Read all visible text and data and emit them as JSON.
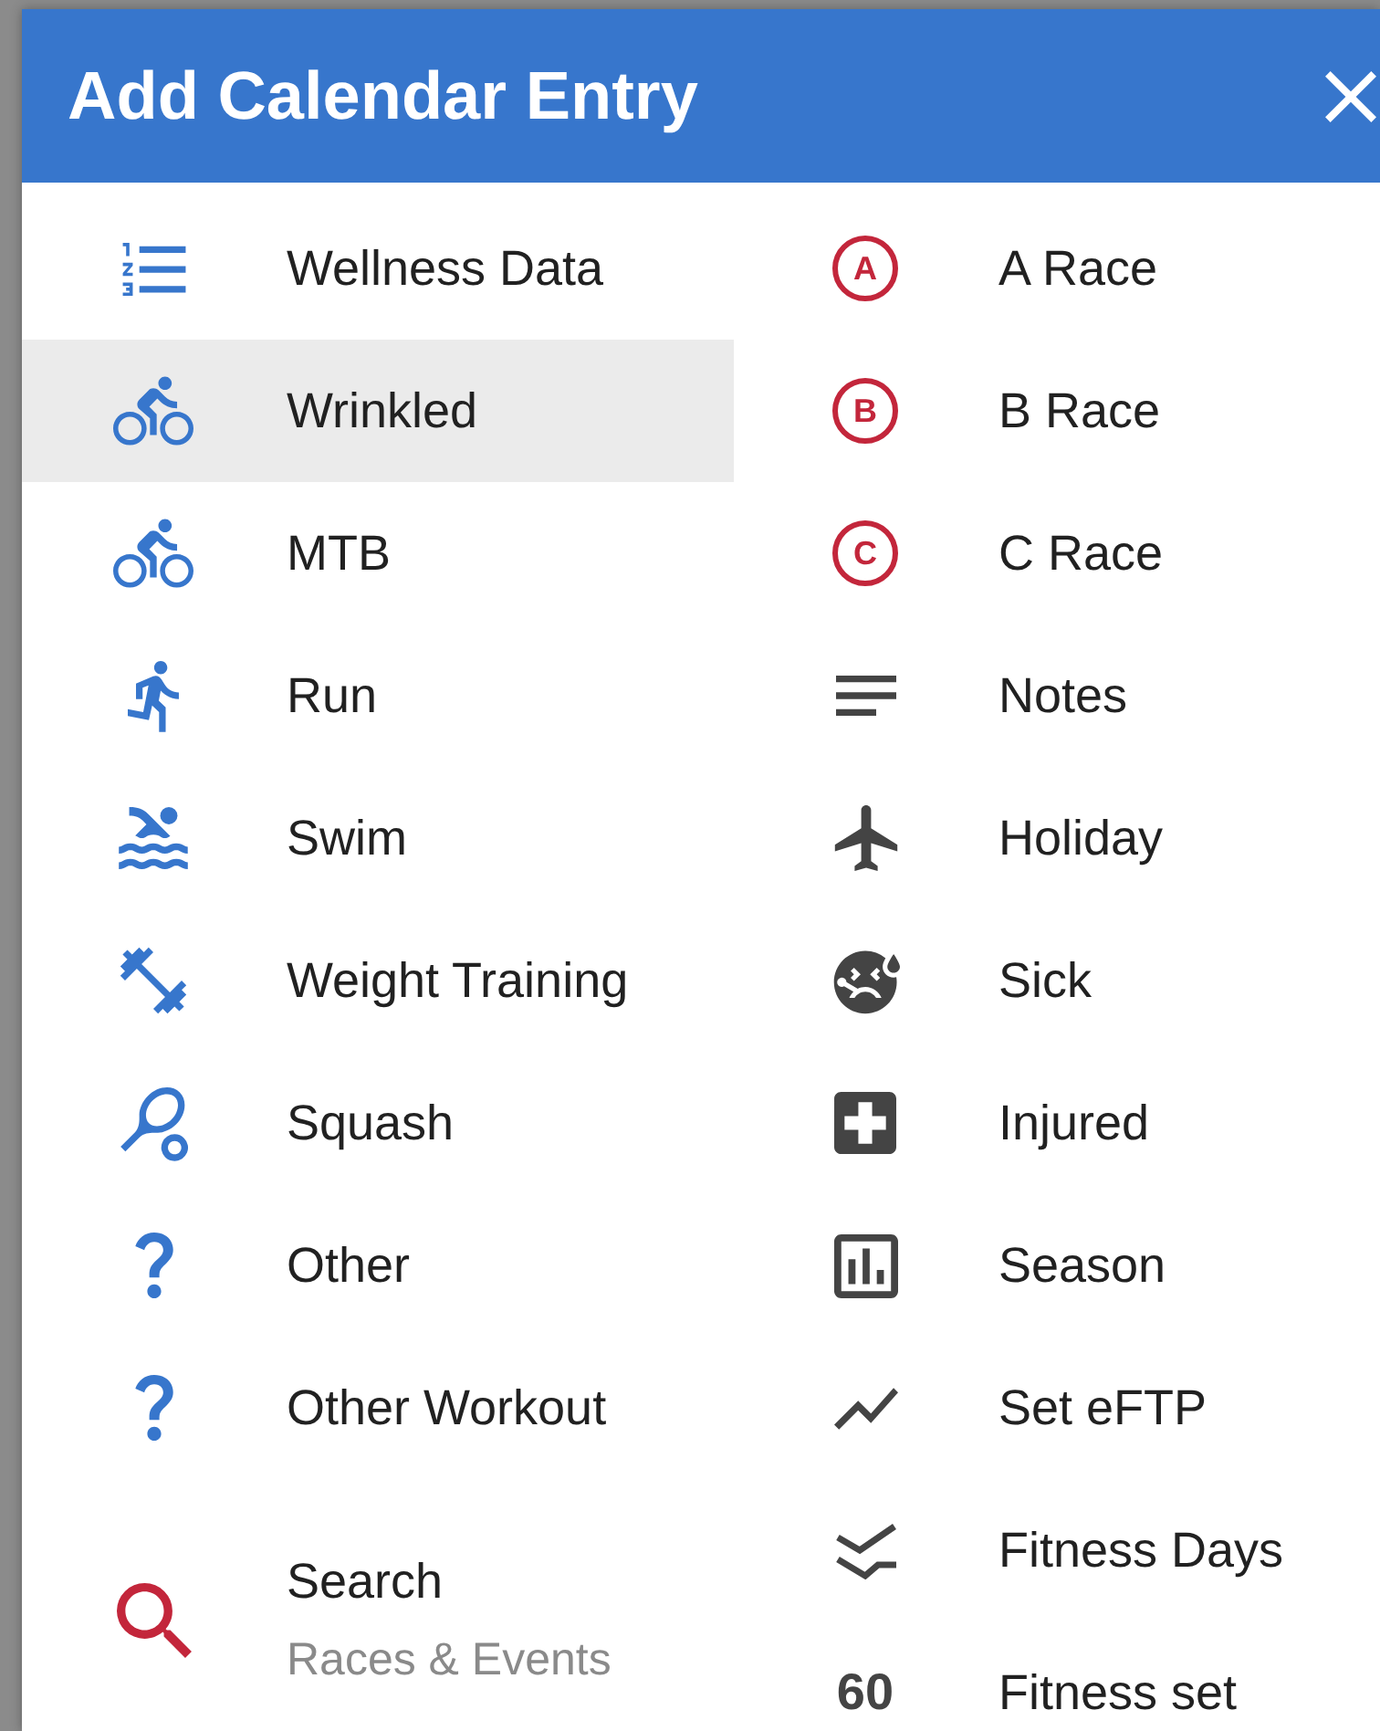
{
  "dialog": {
    "title": "Add Calendar Entry"
  },
  "left_items": [
    {
      "label": "Wellness Data",
      "kind": "activity",
      "selected": false
    },
    {
      "label": "Wrinkled",
      "kind": "activity",
      "selected": true
    },
    {
      "label": "MTB",
      "kind": "activity",
      "selected": false
    },
    {
      "label": "Run",
      "kind": "activity",
      "selected": false
    },
    {
      "label": "Swim",
      "kind": "activity",
      "selected": false
    },
    {
      "label": "Weight Training",
      "kind": "activity",
      "selected": false
    },
    {
      "label": "Squash",
      "kind": "activity",
      "selected": false
    },
    {
      "label": "Other",
      "kind": "activity",
      "selected": false
    },
    {
      "label": "Other Workout",
      "kind": "activity",
      "selected": false
    }
  ],
  "search_item": {
    "label": "Search",
    "sublabel": "Races & Events",
    "selected": false
  },
  "right_items": [
    {
      "label": "A Race",
      "kind": "race",
      "badge": "A",
      "selected": false
    },
    {
      "label": "B Race",
      "kind": "race",
      "badge": "B",
      "selected": false
    },
    {
      "label": "C Race",
      "kind": "race",
      "badge": "C",
      "selected": false
    },
    {
      "label": "Notes",
      "kind": "event",
      "selected": false
    },
    {
      "label": "Holiday",
      "kind": "event",
      "selected": false
    },
    {
      "label": "Sick",
      "kind": "event",
      "selected": false
    },
    {
      "label": "Injured",
      "kind": "event",
      "selected": false
    },
    {
      "label": "Season",
      "kind": "event",
      "selected": false
    },
    {
      "label": "Set eFTP",
      "kind": "event",
      "selected": false
    },
    {
      "label": "Fitness Days",
      "kind": "event",
      "selected": false
    },
    {
      "label": "Fitness set",
      "kind": "number",
      "badge": "60",
      "selected": false
    }
  ]
}
